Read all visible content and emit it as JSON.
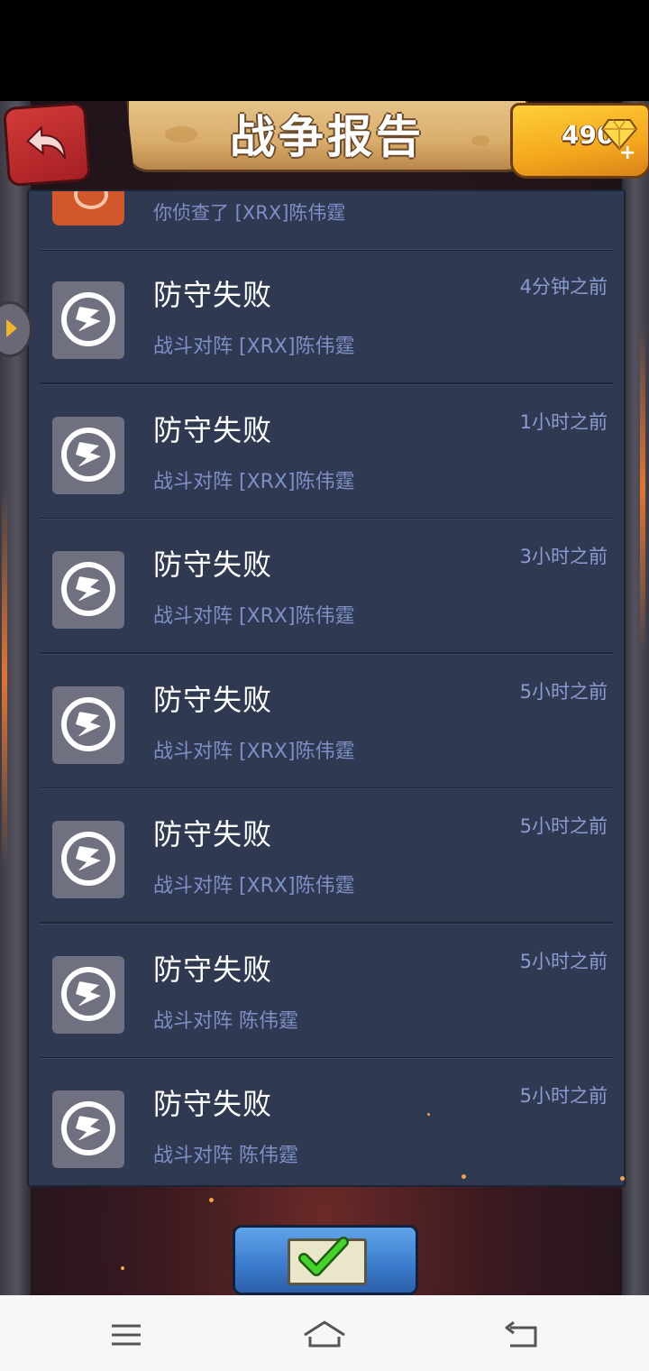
{
  "header": {
    "title": "战争报告",
    "gems": "490"
  },
  "partial_row": {
    "subtitle": "你侦查了 [XRX]陈伟霆"
  },
  "reports": [
    {
      "title": "防守失败",
      "subtitle": "战斗对阵 [XRX]陈伟霆",
      "time": "4分钟之前"
    },
    {
      "title": "防守失败",
      "subtitle": "战斗对阵 [XRX]陈伟霆",
      "time": "1小时之前"
    },
    {
      "title": "防守失败",
      "subtitle": "战斗对阵 [XRX]陈伟霆",
      "time": "3小时之前"
    },
    {
      "title": "防守失败",
      "subtitle": "战斗对阵 [XRX]陈伟霆",
      "time": "5小时之前"
    },
    {
      "title": "防守失败",
      "subtitle": "战斗对阵 [XRX]陈伟霆",
      "time": "5小时之前"
    },
    {
      "title": "防守失败",
      "subtitle": "战斗对阵 陈伟霆",
      "time": "5小时之前"
    },
    {
      "title": "防守失败",
      "subtitle": "战斗对阵 陈伟霆",
      "time": "5小时之前"
    }
  ],
  "icons": {
    "back": "back-arrow-icon",
    "gem": "diamond-icon",
    "report": "broken-shield-icon",
    "confirm": "envelope-check-icon"
  },
  "colors": {
    "panel": "#2f3a52",
    "subtitle": "#7d8fc5",
    "banner": "#d9ad6b",
    "gem_box": "#f4a81d",
    "back_button": "#c22d2f",
    "confirm_button": "#3a7bcc"
  }
}
